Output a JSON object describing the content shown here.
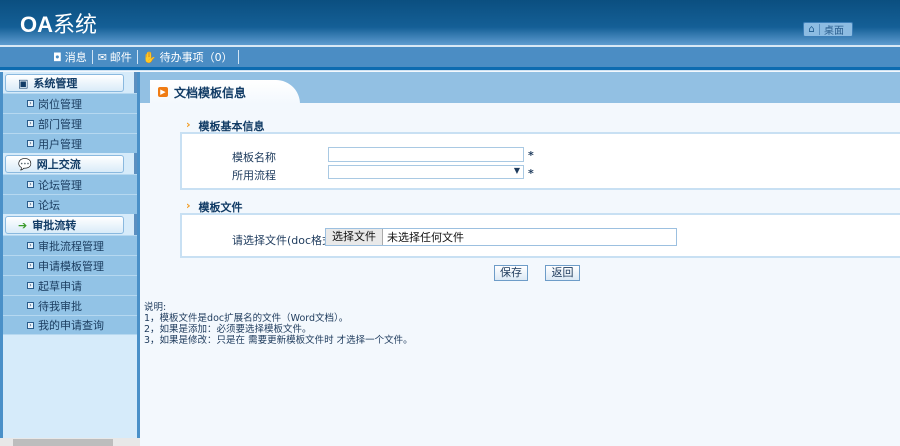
{
  "header": {
    "logo_bold": "OA",
    "logo_text": "系统",
    "desktop_label": "桌面"
  },
  "nav": [
    {
      "icon": "message-icon",
      "label": "消息"
    },
    {
      "icon": "mail-icon",
      "label": "邮件"
    },
    {
      "icon": "hand-icon",
      "label": "待办事项（0）"
    }
  ],
  "sidebar": {
    "groups": [
      {
        "label": "系统管理",
        "items": [
          "岗位管理",
          "部门管理",
          "用户管理"
        ]
      },
      {
        "label": "网上交流",
        "items": [
          "论坛管理",
          "论坛"
        ]
      },
      {
        "label": "审批流转",
        "items": [
          "审批流程管理",
          "申请模板管理",
          "起草申请",
          "待我审批",
          "我的申请查询"
        ]
      }
    ]
  },
  "page": {
    "tab_title": "文档模板信息",
    "section1": {
      "title": "模板基本信息",
      "name_label": "模板名称",
      "name_value": "",
      "flow_label": "所用流程",
      "flow_value": "",
      "required": "*"
    },
    "section2": {
      "title": "模板文件",
      "file_label": "请选择文件(doc格式)",
      "choose_button": "选择文件",
      "no_file": "未选择任何文件"
    },
    "save": "保存",
    "back": "返回",
    "notes": [
      "说明:",
      "1，模板文件是doc扩展名的文件（Word文档）。",
      "2，如果是添加：必须要选择模板文件。",
      "3，如果是修改：只是在 需要更新模板文件时 才选择一个文件。"
    ]
  }
}
